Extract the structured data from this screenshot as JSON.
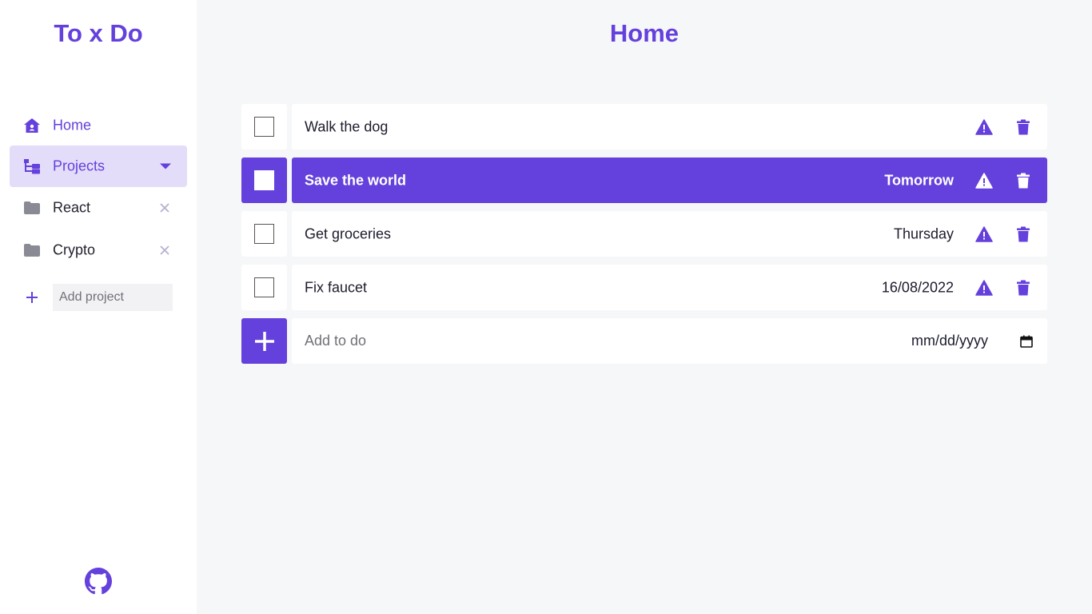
{
  "app": {
    "logo": "To x Do"
  },
  "sidebar": {
    "nav": [
      {
        "label": "Home",
        "icon": "home-icon"
      },
      {
        "label": "Projects",
        "icon": "folder-tree-icon"
      }
    ],
    "projects": [
      {
        "label": "React",
        "icon": "folder-icon"
      },
      {
        "label": "Crypto",
        "icon": "folder-icon"
      }
    ],
    "add_project_placeholder": "Add project"
  },
  "main": {
    "title": "Home",
    "todos": [
      {
        "text": "Walk the dog",
        "date": "",
        "selected": false
      },
      {
        "text": "Save the world",
        "date": "Tomorrow",
        "selected": true
      },
      {
        "text": "Get groceries",
        "date": "Thursday",
        "selected": false
      },
      {
        "text": "Fix faucet",
        "date": "16/08/2022",
        "selected": false
      }
    ],
    "add_todo_placeholder": "Add to do",
    "date_placeholder": "mm/dd/yyyy"
  },
  "colors": {
    "accent": "#6440dc",
    "accent_light": "#e3ddfa",
    "background": "#f6f7f9",
    "muted": "#8a8a94"
  }
}
